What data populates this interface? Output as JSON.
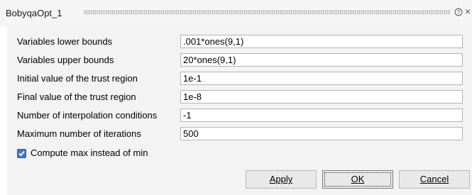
{
  "window": {
    "title": "BobyqaOpt_1",
    "help_symbol": "?",
    "close_symbol": "×"
  },
  "fields": [
    {
      "label": "Variables lower bounds",
      "value": ".001*ones(9,1)"
    },
    {
      "label": "Variables upper bounds",
      "value": "20*ones(9,1)"
    },
    {
      "label": "Initial value of the trust region",
      "value": "1e-1"
    },
    {
      "label": "Final value of the trust region",
      "value": "1e-8"
    },
    {
      "label": "Number of interpolation conditions",
      "value": "-1"
    },
    {
      "label": "Maximum number of iterations",
      "value": "500"
    }
  ],
  "checkbox": {
    "label": "Compute max instead of min",
    "checked": true
  },
  "buttons": {
    "apply": "Apply",
    "ok": "OK",
    "cancel": "Cancel"
  },
  "colors": {
    "accent": "#3a78c8",
    "panel": "#f3f3f3"
  }
}
